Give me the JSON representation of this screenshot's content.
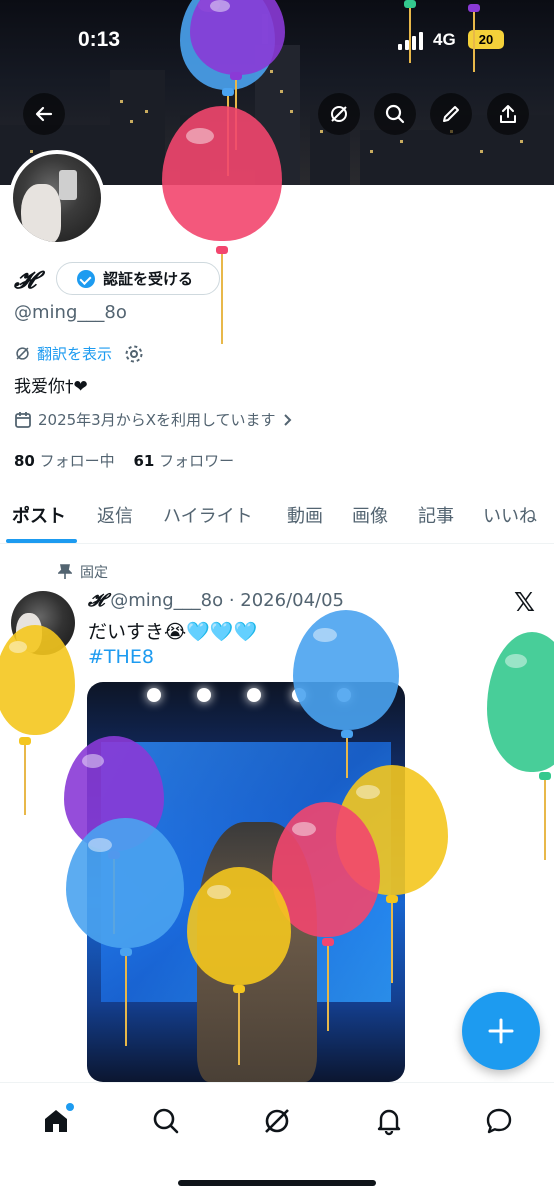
{
  "status_bar": {
    "time": "0:13",
    "network": "4G",
    "battery": "20"
  },
  "header": {
    "back_icon": "arrow-left-icon",
    "actions": [
      "grok-icon",
      "search-icon",
      "edit-icon",
      "share-icon"
    ]
  },
  "profile": {
    "display_name": "𝓗",
    "verify_button": "認証を受ける",
    "handle": "@ming___8o",
    "translate_label": "翻訳を表示",
    "bio": "我爱你†❤",
    "joined": "2025年3月からXを利用しています",
    "following_count": "80",
    "following_label": "フォロー中",
    "followers_count": "61",
    "followers_label": "フォロワー"
  },
  "tabs": [
    "ポスト",
    "返信",
    "ハイライト",
    "動画",
    "画像",
    "記事",
    "いいね"
  ],
  "active_tab": "ポスト",
  "post": {
    "pinned_label": "固定",
    "author_name": "𝓗",
    "author_handle": "@ming___8o",
    "date": "2026/04/05",
    "text": "だいすき😭🩵🩵🩵",
    "hashtag": "#THE8"
  },
  "fab": {
    "icon": "compose-plus-icon"
  },
  "bottom_nav": [
    "home-icon",
    "search-icon",
    "grok-icon",
    "notifications-icon",
    "messages-icon"
  ],
  "colors": {
    "accent": "#1d9bf0",
    "text": "#0f1419",
    "secondary": "#536471"
  }
}
